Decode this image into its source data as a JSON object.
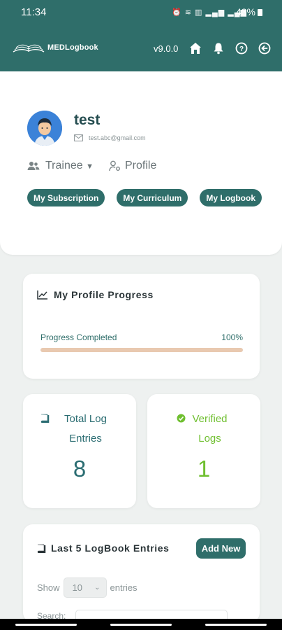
{
  "status_bar": {
    "time": "11:34",
    "battery": "43%",
    "icons": [
      "alarm-icon",
      "wifi-icon",
      "volte-icon",
      "signal-icon",
      "signal-icon"
    ]
  },
  "header": {
    "brand": "MEDLogbook",
    "version": "v9.0.0",
    "icons": [
      "home-icon",
      "bell-icon",
      "help-icon",
      "logout-icon"
    ],
    "color": "#2f6e6a"
  },
  "profile": {
    "name": "test",
    "email": "test.abc@gmail.com",
    "role": "Trainee",
    "profile_link": "Profile",
    "buttons": [
      "My Subscription",
      "My Curriculum",
      "My Logbook"
    ]
  },
  "progress": {
    "title": "My Profile Progress",
    "label": "Progress Completed",
    "value_text": "100%",
    "fraction": 1.0,
    "fill_color": "#e9c9b0"
  },
  "stats": {
    "total": {
      "label": "Total Log Entries",
      "value": "8",
      "color": "#2b6d72"
    },
    "verified": {
      "label": "Verified Logs",
      "value": "1",
      "color": "#6fbf2f"
    }
  },
  "logbook": {
    "title": "Last 5 LogBook Entries",
    "add_button": "Add New",
    "show_label": "Show",
    "page_size": "10",
    "entries_label": "entries",
    "search_label": "Search:"
  }
}
